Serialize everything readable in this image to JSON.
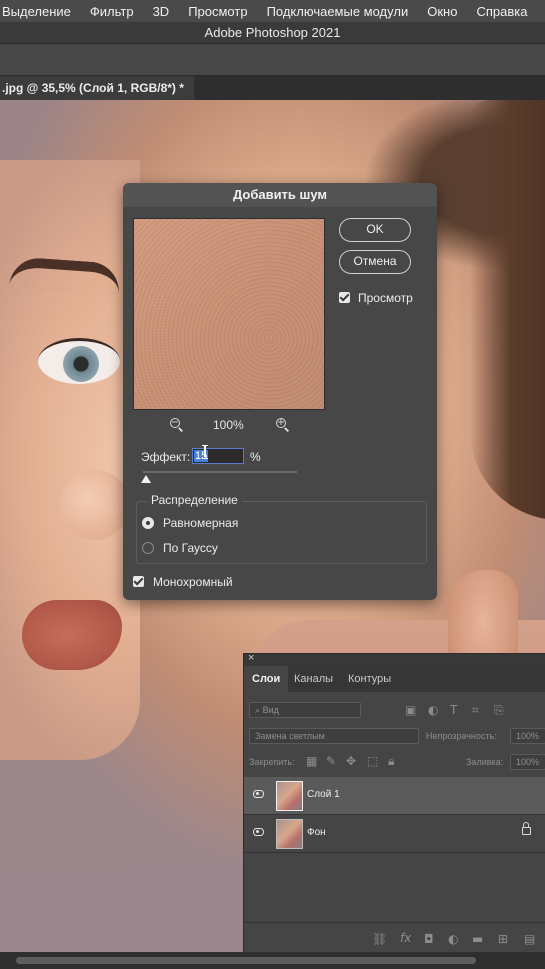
{
  "menu": [
    "Выделение",
    "Фильтр",
    "3D",
    "Просмотр",
    "Подключаемые модули",
    "Окно",
    "Справка"
  ],
  "app_title": "Adobe Photoshop 2021",
  "document_tab": ".jpg @ 35,5% (Слой 1, RGB/8*) *",
  "dialog": {
    "title": "Добавить шум",
    "ok_label": "OK",
    "cancel_label": "Отмена",
    "preview_label": "Просмотр",
    "preview_checked": true,
    "zoom": "100%",
    "effect_label": "Эффект:",
    "effect_value": "15",
    "effect_unit": "%",
    "distribution_title": "Распределение",
    "uniform_label": "Равномерная",
    "gaussian_label": "По Гауссу",
    "selected_distribution": "uniform",
    "monochrome_label": "Монохромный",
    "monochrome_checked": true
  },
  "layers_panel": {
    "close": "×",
    "tabs": [
      "Слои",
      "Каналы",
      "Контуры"
    ],
    "active_tab": "Слои",
    "filter_placeholder": "Вид",
    "blend_mode": "Замена светлым",
    "opacity_label": "Непрозрачность:",
    "opacity_value": "100%",
    "lock_label": "Закрепить:",
    "fill_label": "Заливка:",
    "fill_value": "100%",
    "layers": [
      {
        "name": "Слой 1",
        "selected": true,
        "visible": true,
        "locked": false
      },
      {
        "name": "Фон",
        "selected": false,
        "visible": true,
        "locked": true
      }
    ],
    "bottom_icons": [
      "link-icon",
      "fx-icon",
      "mask-icon",
      "adjustment-icon",
      "folder-icon",
      "new-layer-icon",
      "trash-icon"
    ]
  },
  "colors": {
    "ui_dark": "#474747",
    "selection_blue": "#4a7fd6",
    "accent_selected_layer": "#5a5a5a"
  }
}
